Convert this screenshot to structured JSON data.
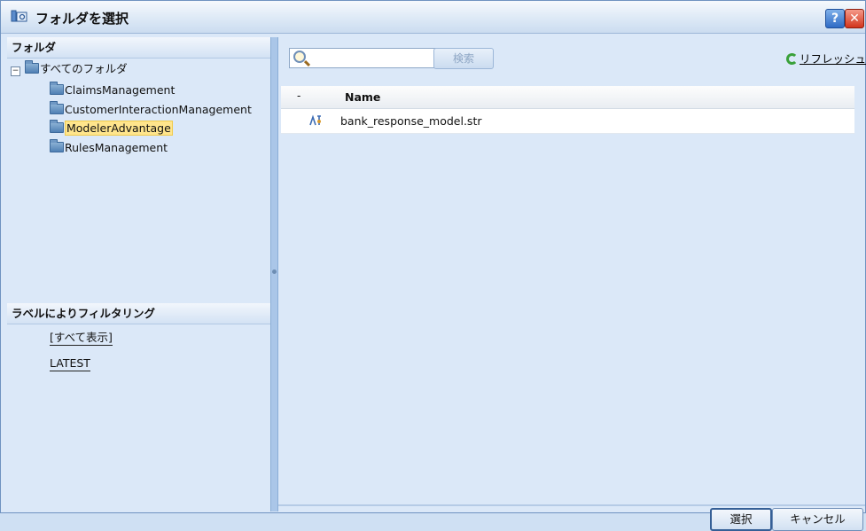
{
  "window": {
    "title": "フォルダを選択",
    "help_glyph": "?",
    "close_glyph": "✕"
  },
  "folders_panel": {
    "header": "フォルダ",
    "root": {
      "expander": "−",
      "label": "すべてのフォルダ"
    },
    "items": [
      {
        "label": "ClaimsManagement",
        "selected": false
      },
      {
        "label": "CustomerInteractionManagement",
        "selected": false
      },
      {
        "label": "ModelerAdvantage",
        "selected": true
      },
      {
        "label": "RulesManagement",
        "selected": false
      }
    ]
  },
  "labels_panel": {
    "header": "ラベルによりフィルタリング",
    "items": [
      "[すべて表示]",
      "LATEST"
    ]
  },
  "search": {
    "value": "",
    "button_label": "検索"
  },
  "refresh": {
    "label": "リフレッシュ"
  },
  "file_list": {
    "columns": {
      "sort": "-",
      "name": "Name"
    },
    "rows": [
      {
        "icon": "stream-file-icon",
        "name": "bank_response_model.str"
      }
    ]
  },
  "footer": {
    "select_label": "選択",
    "cancel_label": "キャンセル"
  },
  "colors": {
    "panel_bg": "#dbe8f8",
    "selection": "#ffe58c",
    "refresh_green": "#3aa13a"
  }
}
